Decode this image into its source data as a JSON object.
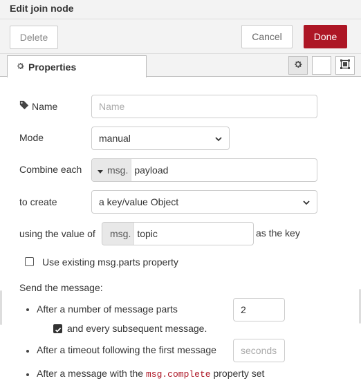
{
  "title": "Edit join node",
  "toolbar": {
    "delete_label": "Delete",
    "cancel_label": "Cancel",
    "done_label": "Done"
  },
  "tabs": {
    "properties_label": "Properties"
  },
  "form": {
    "name_label": "Name",
    "name_placeholder": "Name",
    "mode_label": "Mode",
    "mode_value": "manual",
    "combine_label": "Combine each",
    "combine_prefix": "msg.",
    "combine_value": "payload",
    "create_label": "to create",
    "create_value": "a key/value Object",
    "using_label": "using the value of",
    "using_prefix": "msg.",
    "using_value": "topic",
    "using_suffix": "as the key",
    "use_parts_label": "Use existing msg.parts property",
    "send_label": "Send the message:",
    "after_parts_label": "After a number of message parts",
    "after_parts_value": "2",
    "subsequent_label": "and every subsequent message.",
    "after_timeout_label": "After a timeout following the first message",
    "timeout_placeholder": "seconds",
    "after_complete_prefix": "After a message with the",
    "after_complete_code": "msg.complete",
    "after_complete_suffix": "property set"
  },
  "colors": {
    "done_bg": "#ad1625",
    "code_text": "#ad1625"
  }
}
